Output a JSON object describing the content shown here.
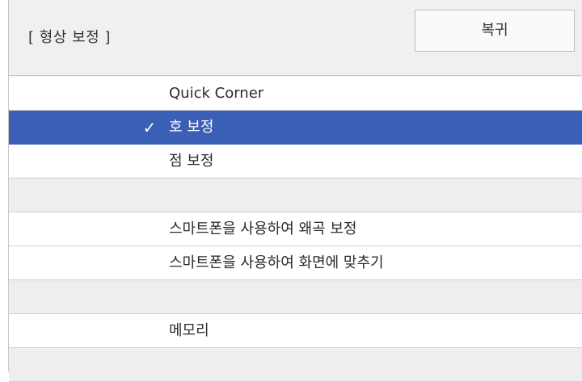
{
  "header": {
    "title": "[ 형상 보정 ]",
    "back_label": "복귀"
  },
  "menu": {
    "items": [
      {
        "label": "Quick Corner",
        "selected": false
      },
      {
        "label": "호 보정",
        "selected": true,
        "check_icon": "✓"
      },
      {
        "label": "점 보정",
        "selected": false
      },
      {
        "label": "",
        "blank": true
      },
      {
        "label": "스마트폰을 사용하여 왜곡 보정",
        "selected": false
      },
      {
        "label": "스마트폰을 사용하여 화면에 맞추기",
        "selected": false
      },
      {
        "label": "",
        "blank": true
      },
      {
        "label": "메모리",
        "selected": false
      },
      {
        "label": "",
        "blank": true
      }
    ]
  },
  "colors": {
    "selected_bg": "#3b5fb5",
    "panel_bg": "#f0f0f0"
  }
}
